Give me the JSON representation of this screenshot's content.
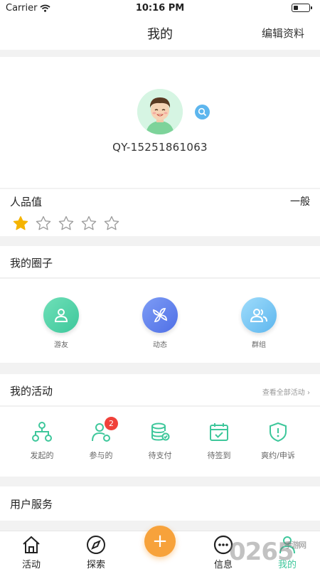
{
  "status_bar": {
    "carrier": "Carrier",
    "time": "10:16 PM",
    "battery_level": 0.3
  },
  "nav": {
    "title": "我的",
    "edit_label": "编辑资料"
  },
  "profile": {
    "user_id": "QY-15251861063"
  },
  "rating": {
    "label": "人品值",
    "level": "一般",
    "stars_filled": 1,
    "stars_total": 5
  },
  "my_circle": {
    "title": "我的圈子",
    "items": [
      {
        "label": "游友",
        "icon": "user-icon"
      },
      {
        "label": "动态",
        "icon": "pinwheel-icon"
      },
      {
        "label": "群组",
        "icon": "group-icon"
      }
    ]
  },
  "my_activities": {
    "title": "我的活动",
    "view_all": "查看全部活动",
    "items": [
      {
        "label": "发起的",
        "icon": "network-icon"
      },
      {
        "label": "参与的",
        "icon": "person-join-icon",
        "badge": "2"
      },
      {
        "label": "待支付",
        "icon": "coins-icon"
      },
      {
        "label": "待签到",
        "icon": "calendar-check-icon"
      },
      {
        "label": "爽约/申诉",
        "icon": "shield-alert-icon"
      }
    ]
  },
  "user_services": {
    "title": "用户服务"
  },
  "tabbar": {
    "tabs": [
      {
        "label": "活动",
        "icon": "home-icon"
      },
      {
        "label": "探索",
        "icon": "compass-icon"
      },
      {
        "label": "",
        "icon": "plus-icon"
      },
      {
        "label": "信息",
        "icon": "message-icon"
      },
      {
        "label": "我的",
        "icon": "profile-icon"
      }
    ],
    "active_index": 4
  },
  "watermark": {
    "text": "0265",
    "subtext": "手游网"
  },
  "colors": {
    "accent_green": "#3ec79b",
    "plus_orange": "#f7a23b",
    "badge_red": "#f0413a",
    "star_yellow": "#f5b400"
  }
}
